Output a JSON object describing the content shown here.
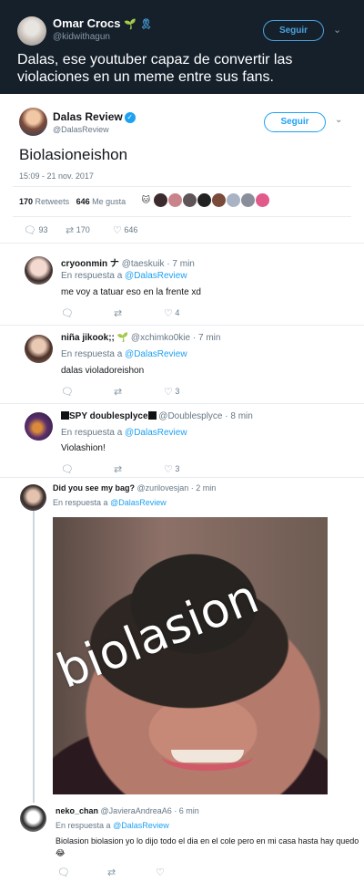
{
  "quote_tweet": {
    "name": "Omar Crocs",
    "handle": "@kidwithagun",
    "follow_label": "Seguir",
    "text": "Dalas, ese youtuber capaz de convertir las violaciones en un meme entre sus fans."
  },
  "main_tweet": {
    "name": "Dalas Review",
    "handle": "@DalasReview",
    "follow_label": "Seguir",
    "text": "Biolasioneishon",
    "date": "15:09 - 21 nov. 2017",
    "retweets_count": "170",
    "retweets_label": "Retweets",
    "likes_count": "646",
    "likes_label": "Me gusta",
    "actions": {
      "replies": "93",
      "retweets": "170",
      "likes": "646"
    }
  },
  "replies": [
    {
      "name": "cryoonmin",
      "name_suffix": "ナ",
      "meta": "@taeskuik · 7 min",
      "in_reply_prefix": "En respuesta a",
      "in_reply_to": "@DalasReview",
      "text": "me voy a tatuar eso en la frente xd",
      "likes": "4"
    },
    {
      "name": "niña jikook;;",
      "meta": "@xchimko0kie · 7 min",
      "in_reply_prefix": "En respuesta a",
      "in_reply_to": "@DalasReview",
      "text": "dalas violadoreishon",
      "likes": "3"
    },
    {
      "name": "SPY doublesplyce",
      "meta": "@Doublesplyce · 8 min",
      "in_reply_prefix": "En respuesta a",
      "in_reply_to": "@DalasReview",
      "text": "Violashion!",
      "likes": "3"
    },
    {
      "name": "Did you see my bag?",
      "meta": "@zurilovesjan · 2 min",
      "in_reply_prefix": "En respuesta a",
      "in_reply_to": "@DalasReview",
      "image_text": "biolasion"
    },
    {
      "name": "neko_chan",
      "meta": "@JavieraAndreaA6 · 6 min",
      "in_reply_prefix": "En respuesta a",
      "in_reply_to": "@DalasReview",
      "text": "Biolasion biolasion yo lo dijo todo el dia en el cole pero en mi casa hasta hay quedo 😂"
    }
  ],
  "colors": {
    "twitter_blue": "#1da1f2",
    "dark_bg": "#15202b",
    "meta_gray": "#657786"
  }
}
